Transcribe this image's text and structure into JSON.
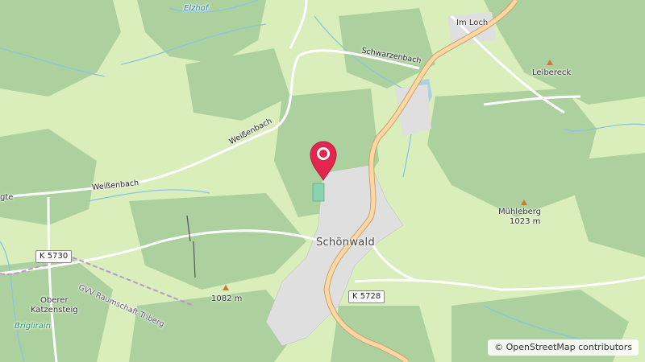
{
  "map": {
    "places": {
      "elzhof": "Elzhof",
      "im_loch": "Im Loch",
      "leibereck": "Leibereck",
      "schoenwald": "Schönwald",
      "muehleberg": "Mühleberg",
      "oberer_katzensteig": "Oberer\nKatzensteig",
      "briglirain": "Briglirain",
      "gte": "gte"
    },
    "peaks": {
      "muehleberg_elev": "1023 m",
      "hill_elev": "1082 m"
    },
    "roads": {
      "schwarzenbach": "Schwarzenbach",
      "weissenbach_1": "Weißenbach",
      "weissenbach_2": "Weißenbach",
      "k5730": "K 5730",
      "k5728": "K 5728"
    },
    "boundary": "GVV Raumschaft Triberg"
  },
  "attribution": {
    "copyright": "©",
    "text": "OpenStreetMap contributors"
  },
  "colors": {
    "meadow": "#d9eebb",
    "forest": "#add19e",
    "water": "#aad3df",
    "stream": "#8cc4df",
    "main_road": "#fcd6a4",
    "main_road_casing": "#c9a56a",
    "residential": "#e0dfdf",
    "marker": "#e2264d"
  }
}
